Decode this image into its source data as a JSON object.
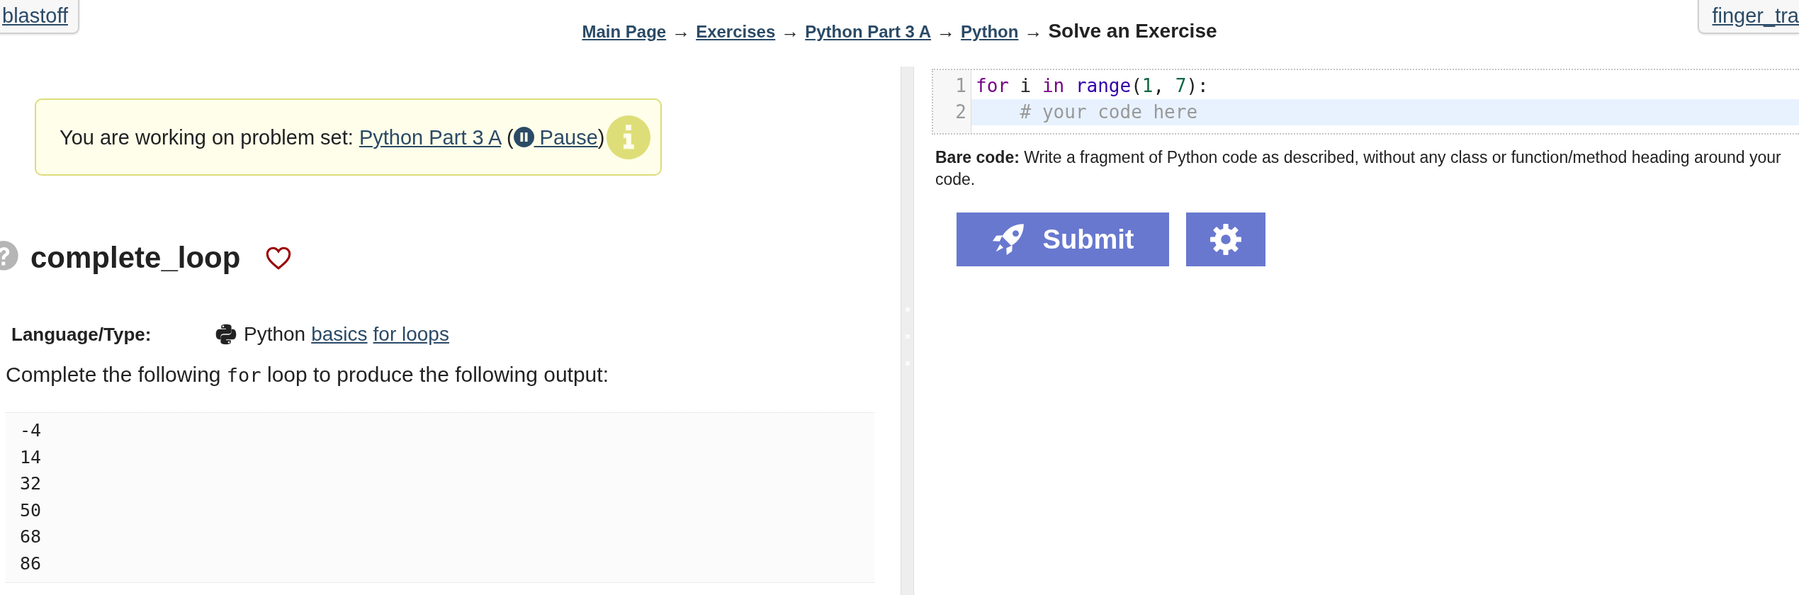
{
  "previous_tab": {
    "label": "blastoff"
  },
  "breadcrumb": [
    {
      "kind": "link",
      "label": "Main Page"
    },
    {
      "kind": "separator",
      "label": "→"
    },
    {
      "kind": "link",
      "label": "Exercises"
    },
    {
      "kind": "separator",
      "label": "→"
    },
    {
      "kind": "link",
      "label": "Python Part 3 A"
    },
    {
      "kind": "separator",
      "label": "→"
    },
    {
      "kind": "link",
      "label": "Python"
    },
    {
      "kind": "separator",
      "label": "→"
    },
    {
      "kind": "current",
      "label": "Solve an Exercise"
    }
  ],
  "next_tab": {
    "label": "finger_tra"
  },
  "notice": {
    "parts": [
      {
        "kind": "text",
        "text": "You are working on problem set: "
      },
      {
        "kind": "link",
        "text": "Python Part 3 A"
      },
      {
        "kind": "text",
        "text": " ("
      },
      {
        "kind": "pause_link",
        "text": "Pause"
      },
      {
        "kind": "text",
        "text": ")"
      }
    ]
  },
  "exercise": {
    "title": "complete_loop",
    "favorite": false
  },
  "language_type": {
    "label": "Language/Type:",
    "language": "Python",
    "tags": [
      "basics",
      "for loops"
    ]
  },
  "prompt": [
    {
      "kind": "text",
      "text": "Complete the following "
    },
    {
      "kind": "code",
      "text": "for"
    },
    {
      "kind": "text",
      "text": " loop to produce the following output:"
    }
  ],
  "expected_output": [
    "-4",
    "14",
    "32",
    "50",
    "68",
    "86"
  ],
  "editor": {
    "lines": [
      {
        "number": "1",
        "active": false,
        "tokens": [
          {
            "kind": "keyword",
            "text": "for"
          },
          {
            "kind": "plain",
            "text": " i "
          },
          {
            "kind": "keyword",
            "text": "in"
          },
          {
            "kind": "builtin",
            "text": " range"
          },
          {
            "kind": "plain",
            "text": "("
          },
          {
            "kind": "number",
            "text": "1"
          },
          {
            "kind": "plain",
            "text": ", "
          },
          {
            "kind": "number",
            "text": "7"
          },
          {
            "kind": "plain",
            "text": "):"
          }
        ]
      },
      {
        "number": "2",
        "active": true,
        "tokens": [
          {
            "kind": "comment",
            "text": "    # your code here"
          }
        ]
      }
    ]
  },
  "hint": "**Bare code:** Write a fragment of Python code as described, without any class or function/method heading around your code.",
  "submit_button": {
    "label": "Submit"
  }
}
